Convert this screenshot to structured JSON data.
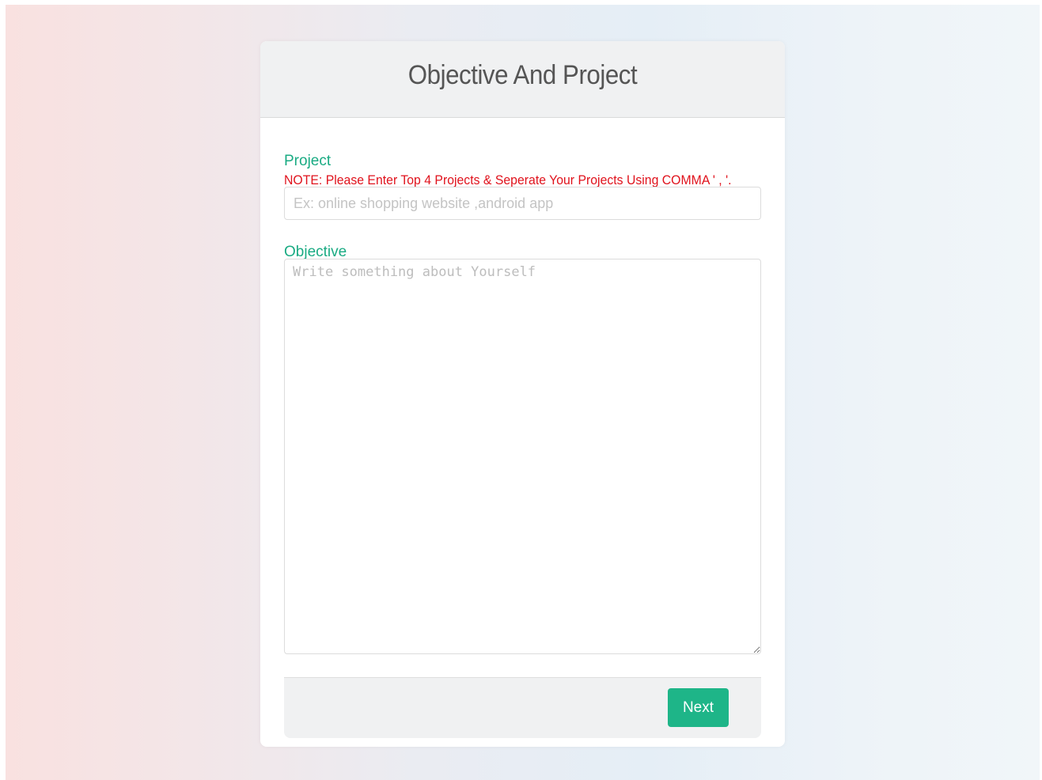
{
  "form": {
    "title": "Objective And Project",
    "project_label": "Project",
    "project_note": "NOTE: Please Enter Top 4 Projects & Seperate Your Projects Using COMMA ' , '.",
    "project_value": "",
    "project_placeholder": "Ex: online shopping website ,android app",
    "objective_label": "Objective",
    "objective_value": "",
    "objective_placeholder": "Write something about Yourself",
    "next_label": "Next"
  },
  "colors": {
    "label_green": "#1aab83",
    "note_red": "#e0121c",
    "button_green": "#1eb588",
    "header_gray": "#f0f1f2"
  }
}
